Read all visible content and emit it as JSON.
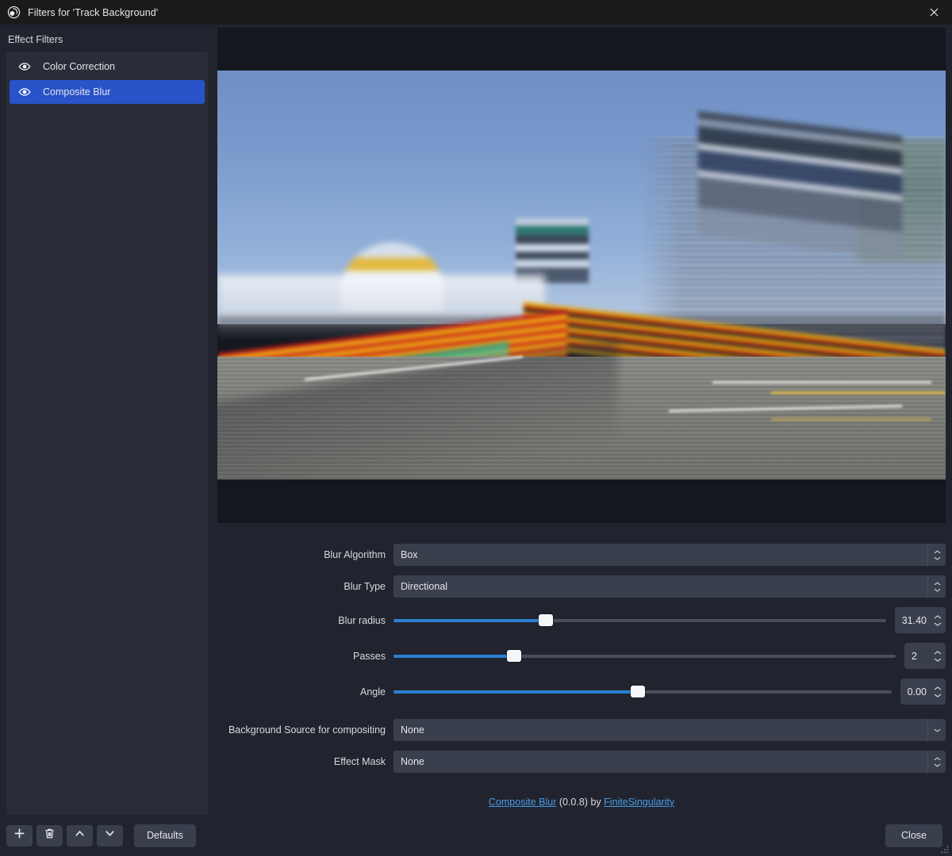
{
  "window": {
    "title": "Filters for 'Track Background'",
    "logo_icon": "obs-logo-icon",
    "close_icon": "close-icon"
  },
  "sidebar": {
    "section_label": "Effect Filters",
    "items": [
      {
        "label": "Color Correction",
        "visibility_icon": "eye-icon",
        "selected": false
      },
      {
        "label": "Composite Blur",
        "visibility_icon": "eye-icon",
        "selected": true
      }
    ],
    "toolbar": {
      "add_icon": "plus-icon",
      "remove_icon": "trash-icon",
      "move_up_icon": "chevron-up-icon",
      "move_down_icon": "chevron-down-icon"
    }
  },
  "properties": {
    "blur_algorithm": {
      "label": "Blur Algorithm",
      "value": "Box"
    },
    "blur_type": {
      "label": "Blur Type",
      "value": "Directional"
    },
    "blur_radius": {
      "label": "Blur radius",
      "value": "31.40",
      "fill_percent": 31
    },
    "passes": {
      "label": "Passes",
      "value": "2",
      "fill_percent": 24
    },
    "angle": {
      "label": "Angle",
      "value": "0.00",
      "fill_percent": 49
    },
    "background_source": {
      "label": "Background Source for compositing",
      "value": "None"
    },
    "effect_mask": {
      "label": "Effect Mask",
      "value": "None"
    }
  },
  "credit": {
    "plugin_name": "Composite Blur",
    "version": "(0.0.8)",
    "by": "by",
    "author": "FiniteSingularity"
  },
  "buttons": {
    "defaults": "Defaults",
    "close": "Close"
  },
  "colors": {
    "accent_blue": "#2953c9",
    "slider_blue": "#2a80d2",
    "link_blue": "#4a9ae8",
    "window_bg": "#21242e",
    "control_bg": "#3a3f4d",
    "list_bg": "#2a2d39",
    "titlebar_bg": "#1a1a1c"
  }
}
